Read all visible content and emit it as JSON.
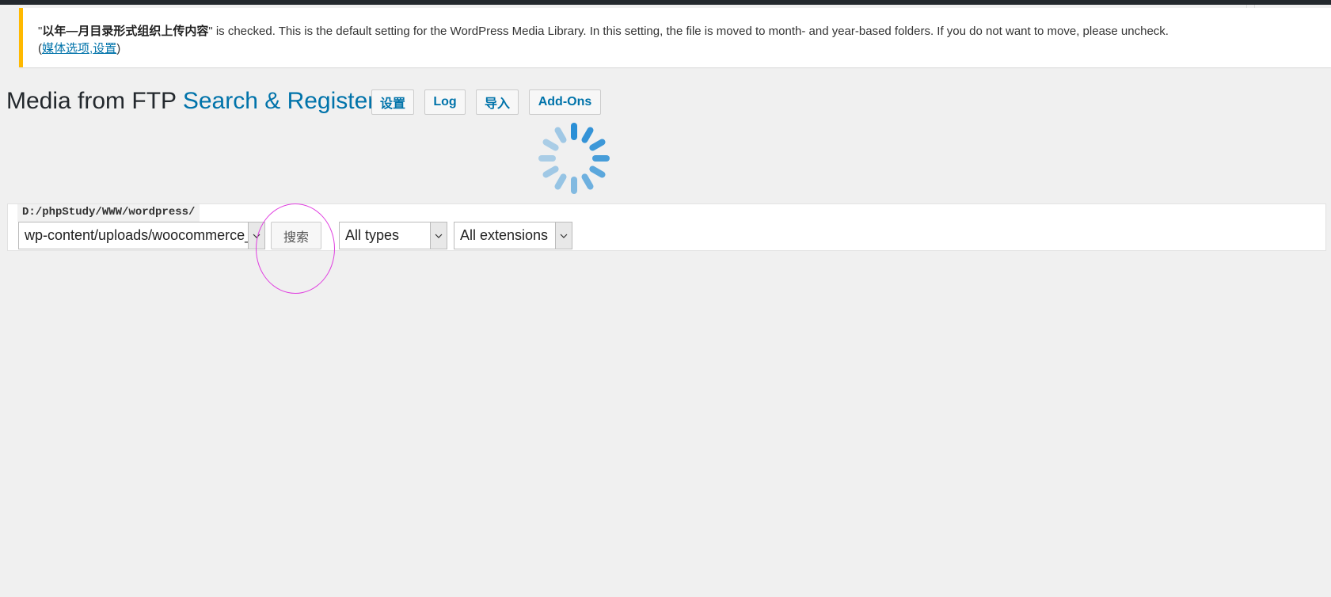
{
  "notice": {
    "setting_name": "以年—月目录形式组织上传内容",
    "message": " is checked. This is the default setting for the WordPress Media Library. In this setting, the file is moved to month- and year-based folders. If you do not want to move, please uncheck.",
    "link_media": "媒体选项",
    "link_settings": "设置",
    "accent_color": "#ffb900"
  },
  "header": {
    "title_plain": "Media from FTP",
    "title_accent": "Search & Register",
    "buttons": {
      "settings": "设置",
      "log": "Log",
      "import": "导入",
      "addons": "Add-Ons"
    }
  },
  "status": {
    "loading": true
  },
  "search": {
    "base_path": "D:/phpStudy/WWW/wordpress/",
    "folder_value": "wp-content/uploads/woocommerce_",
    "search_button": "搜索",
    "type_filter": "All types",
    "extension_filter": "All extensions"
  },
  "colors": {
    "link": "#0073aa",
    "highlight": "#e040e0"
  }
}
